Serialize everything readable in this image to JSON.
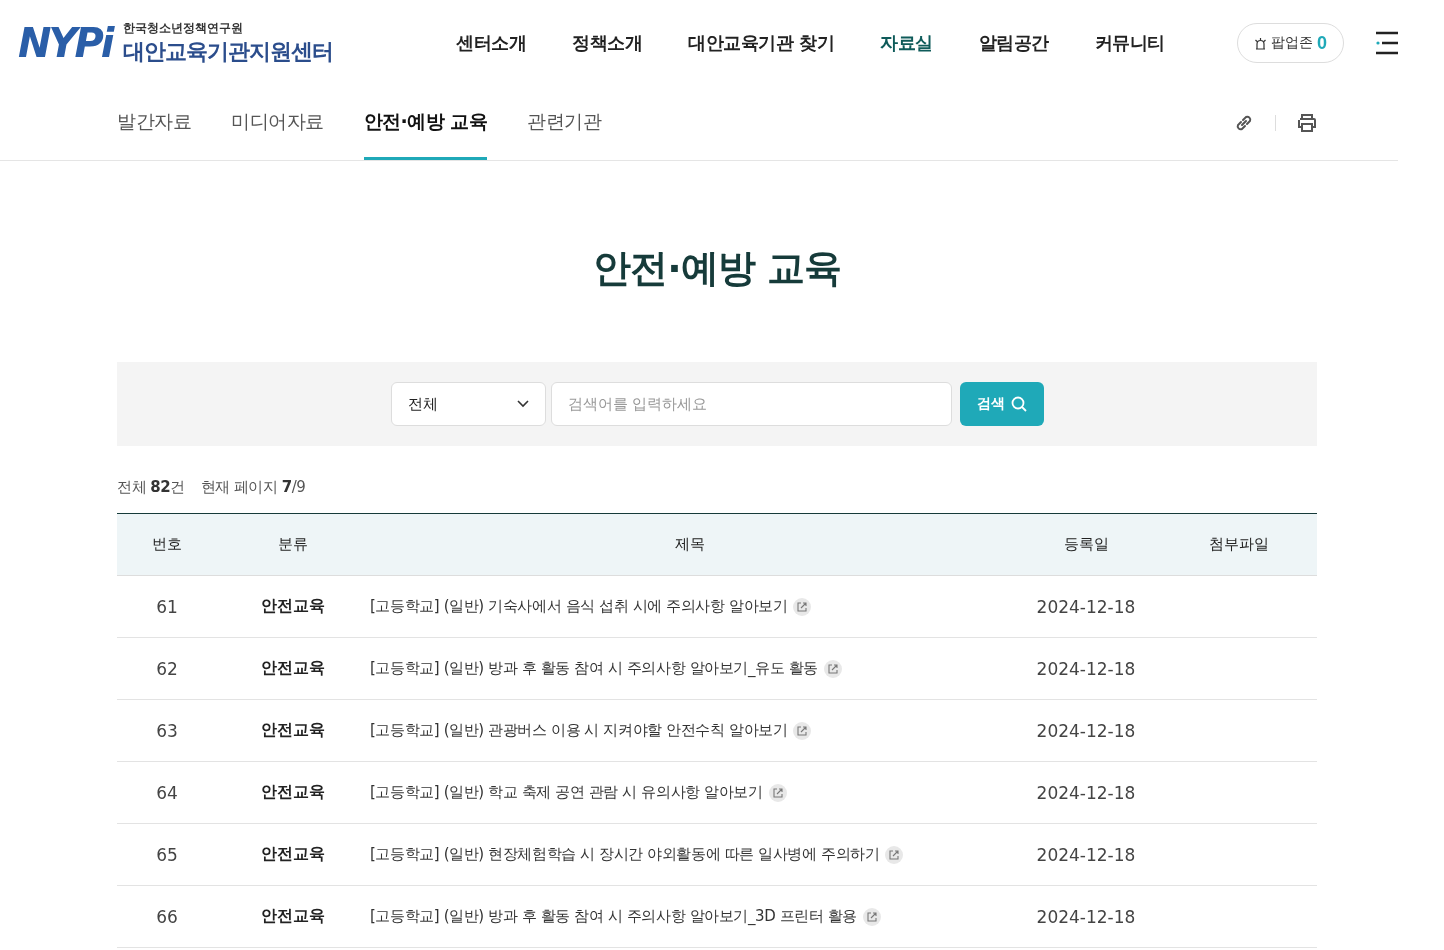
{
  "logo": {
    "mark": "NYPi",
    "org": "한국청소년정책연구원",
    "center": "대안교육기관지원센터"
  },
  "nav": [
    {
      "label": "센터소개",
      "selected": false
    },
    {
      "label": "정책소개",
      "selected": false
    },
    {
      "label": "대안교육기관 찾기",
      "selected": false
    },
    {
      "label": "자료실",
      "selected": true
    },
    {
      "label": "알림공간",
      "selected": false
    },
    {
      "label": "커뮤니티",
      "selected": false
    }
  ],
  "popup_zone": {
    "label": "팝업존",
    "count": "0"
  },
  "subtabs": [
    {
      "label": "발간자료",
      "selected": false
    },
    {
      "label": "미디어자료",
      "selected": false
    },
    {
      "label": "안전·예방 교육",
      "selected": true
    },
    {
      "label": "관련기관",
      "selected": false
    }
  ],
  "page_title": "안전·예방 교육",
  "search": {
    "category": "전체",
    "placeholder": "검색어를 입력하세요",
    "button": "검색"
  },
  "summary": {
    "total": "전체 **82**건",
    "page": "현재 페이지 **7**/9"
  },
  "table": {
    "columns": [
      "번호",
      "분류",
      "제목",
      "등록일",
      "첨부파일"
    ],
    "rows": [
      {
        "no": "61",
        "category": "안전교육",
        "title": "[고등학교] (일반) 기숙사에서 음식 섭취 시에 주의사항 알아보기",
        "date": "2024-12-18"
      },
      {
        "no": "62",
        "category": "안전교육",
        "title": "[고등학교] (일반) 방과 후 활동 참여 시 주의사항 알아보기_유도 활동",
        "date": "2024-12-18"
      },
      {
        "no": "63",
        "category": "안전교육",
        "title": "[고등학교] (일반) 관광버스 이용 시 지켜야할 안전수칙 알아보기",
        "date": "2024-12-18"
      },
      {
        "no": "64",
        "category": "안전교육",
        "title": "[고등학교] (일반) 학교 축제 공연 관람 시 유의사항 알아보기",
        "date": "2024-12-18"
      },
      {
        "no": "65",
        "category": "안전교육",
        "title": "[고등학교] (일반) 현장체험학습 시 장시간 야외활동에 따른 일사병에 주의하기",
        "date": "2024-12-18"
      },
      {
        "no": "66",
        "category": "안전교육",
        "title": "[고등학교] (일반) 방과 후 활동 참여 시 주의사항 알아보기_3D 프린터 활용",
        "date": "2024-12-18"
      }
    ]
  }
}
